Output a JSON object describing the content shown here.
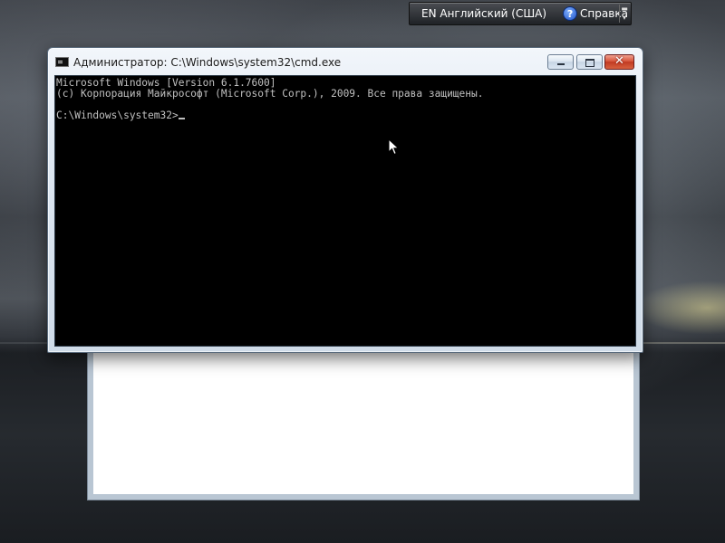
{
  "language_bar": {
    "language": "EN Английский (США)",
    "help_label": "Справка",
    "help_icon": "?"
  },
  "cmd_window": {
    "title": "Администратор: C:\\Windows\\system32\\cmd.exe",
    "close_glyph": "✕",
    "console": {
      "line1": "Microsoft Windows [Version 6.1.7600]",
      "line2": "(c) Корпорация Майкрософт (Microsoft Corp.), 2009. Все права защищены.",
      "line3": "",
      "prompt": "C:\\Windows\\system32>"
    }
  },
  "icons": {
    "window_icon": "cmd-icon",
    "help_icon": "help-icon",
    "pointer": "arrow-pointer"
  }
}
